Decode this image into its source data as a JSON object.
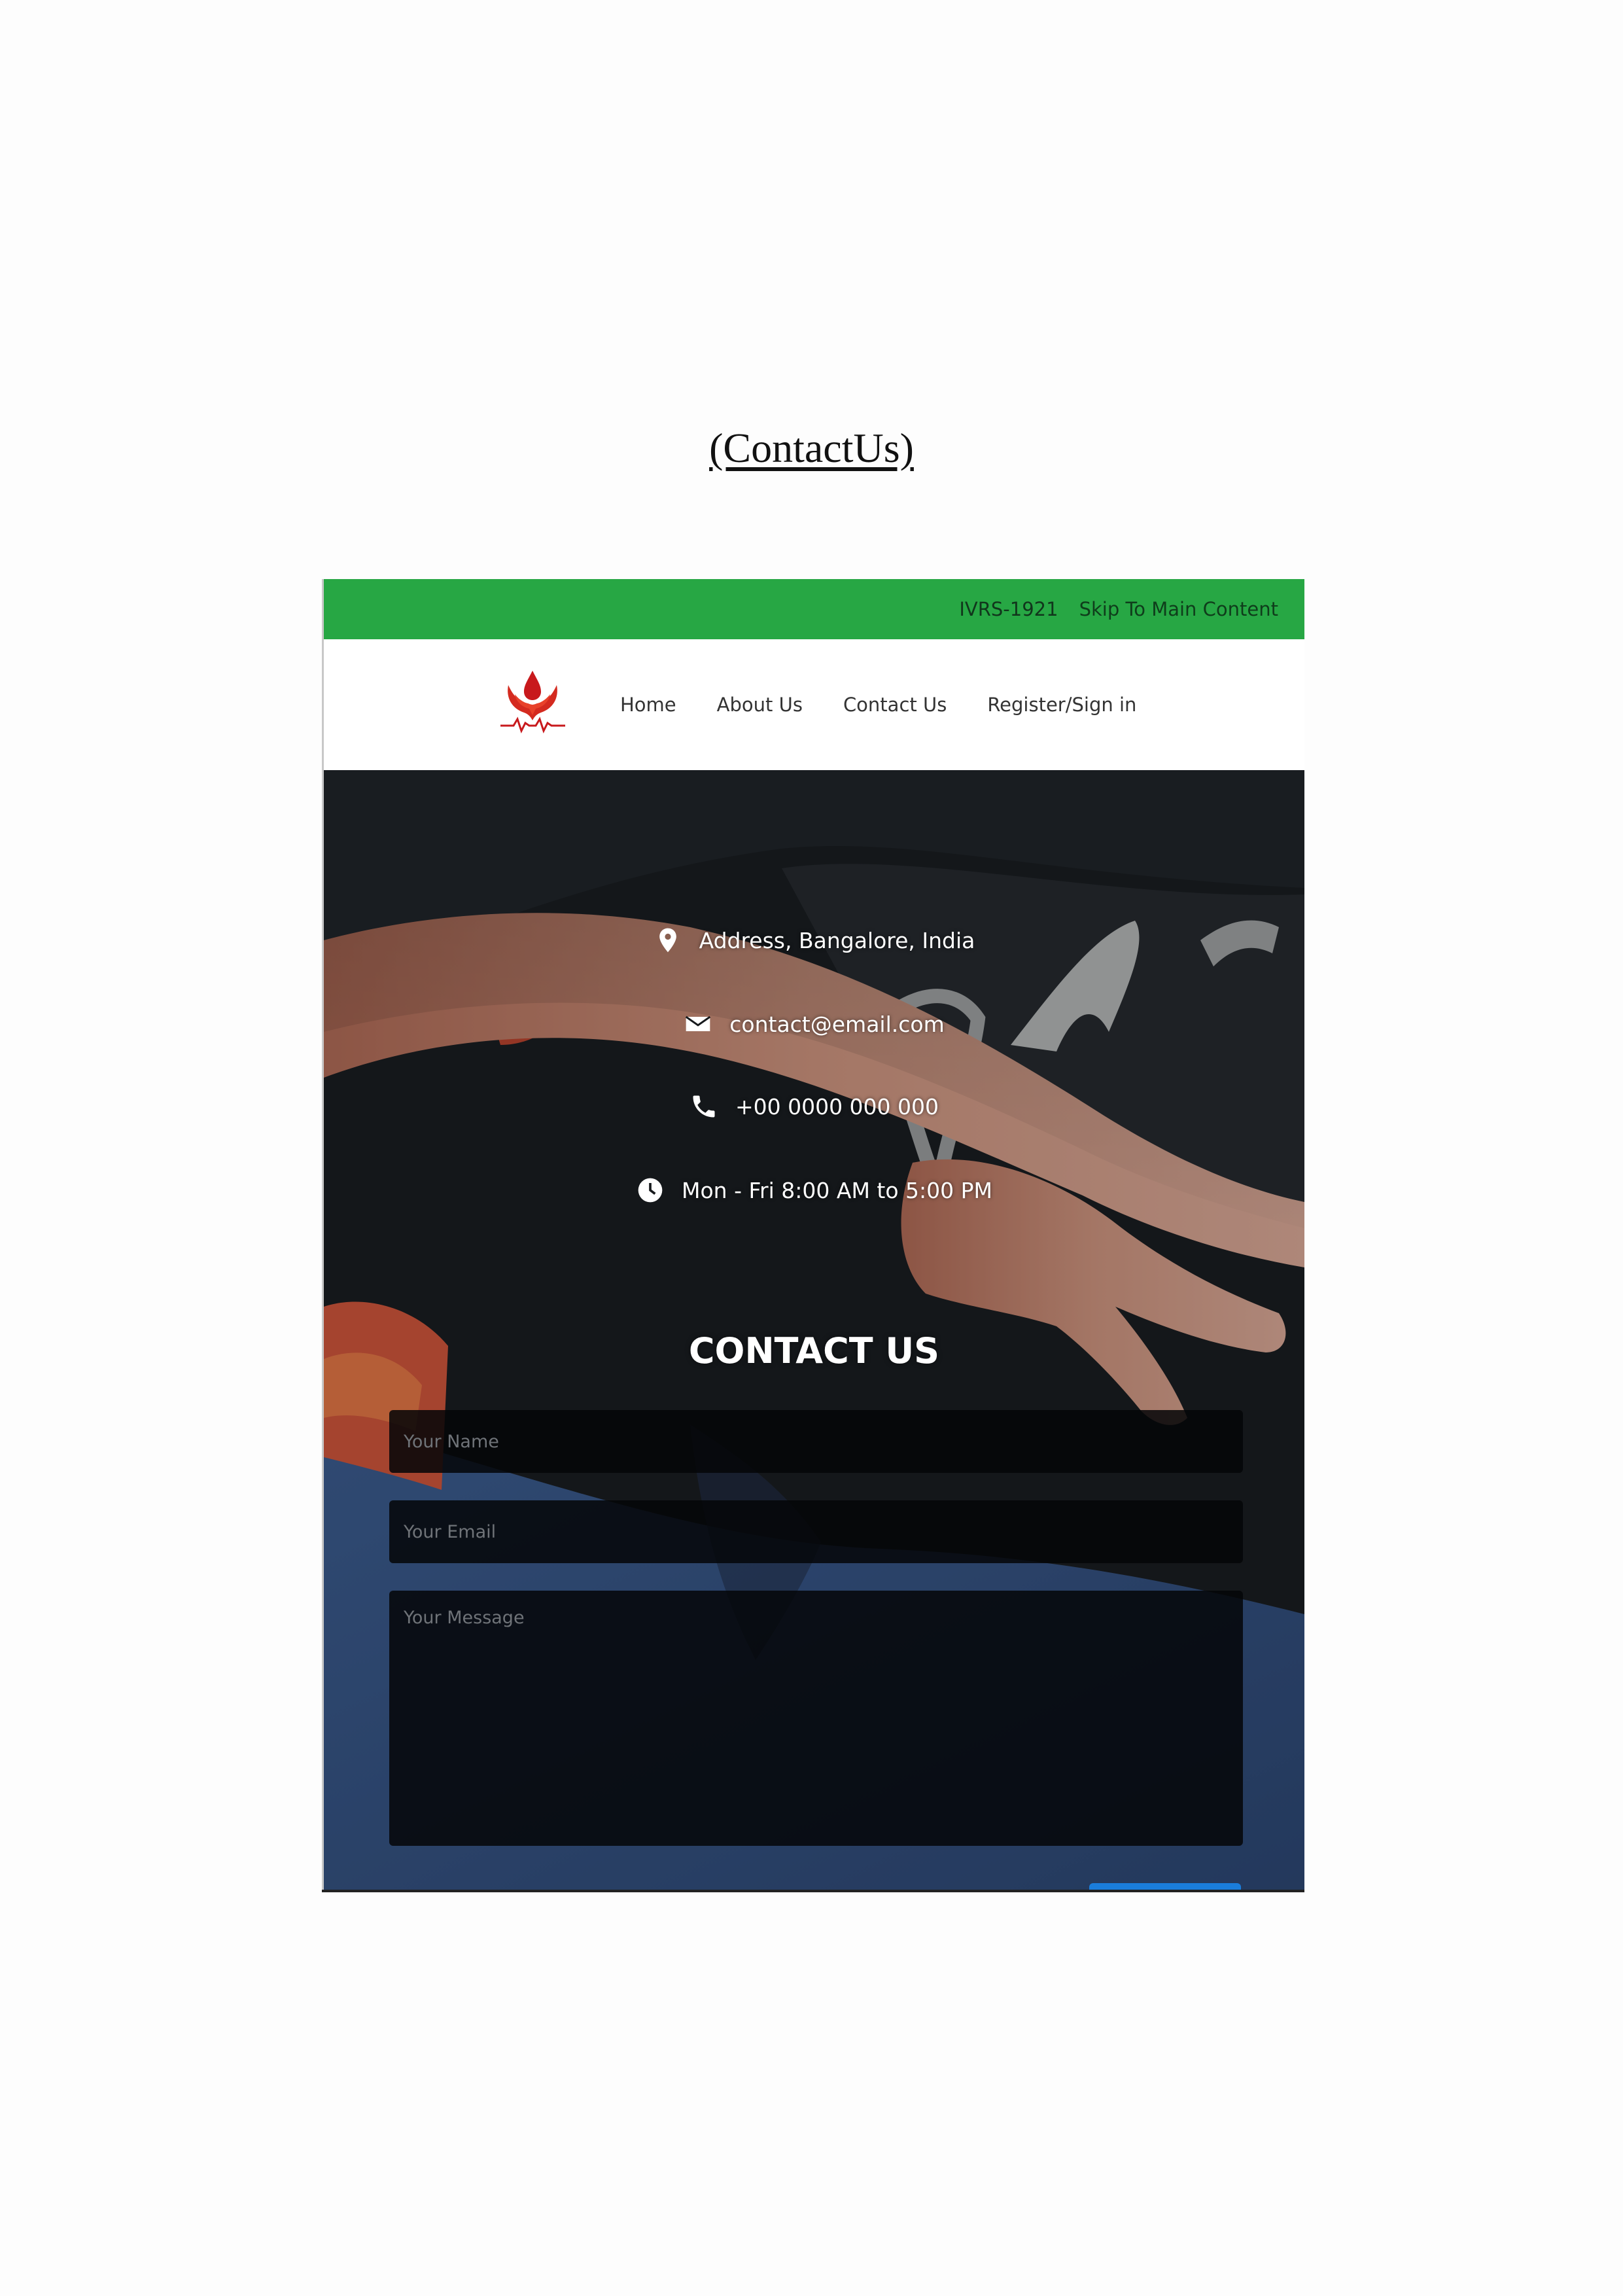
{
  "document": {
    "title": "(ContactUs)"
  },
  "topbar": {
    "ivrs": "IVRS-1921",
    "skip_link": "Skip To Main Content",
    "color": "#27a744"
  },
  "nav": {
    "logo": "blood-drop-hands-logo",
    "items": [
      "Home",
      "About Us",
      "Contact Us",
      "Register/Sign in"
    ]
  },
  "contact_info": {
    "address": "Address, Bangalore, India",
    "email": "contact@email.com",
    "phone": "+00 0000 000 000",
    "hours": "Mon - Fri 8:00 AM to 5:00 PM"
  },
  "form": {
    "heading": "CONTACT US",
    "name_placeholder": "Your Name",
    "email_placeholder": "Your Email",
    "message_placeholder": "Your Message",
    "submit_color": "#1a7ddb"
  },
  "icons": {
    "address": "map-marker-icon",
    "email": "envelope-icon",
    "phone": "phone-icon",
    "hours": "clock-icon"
  }
}
